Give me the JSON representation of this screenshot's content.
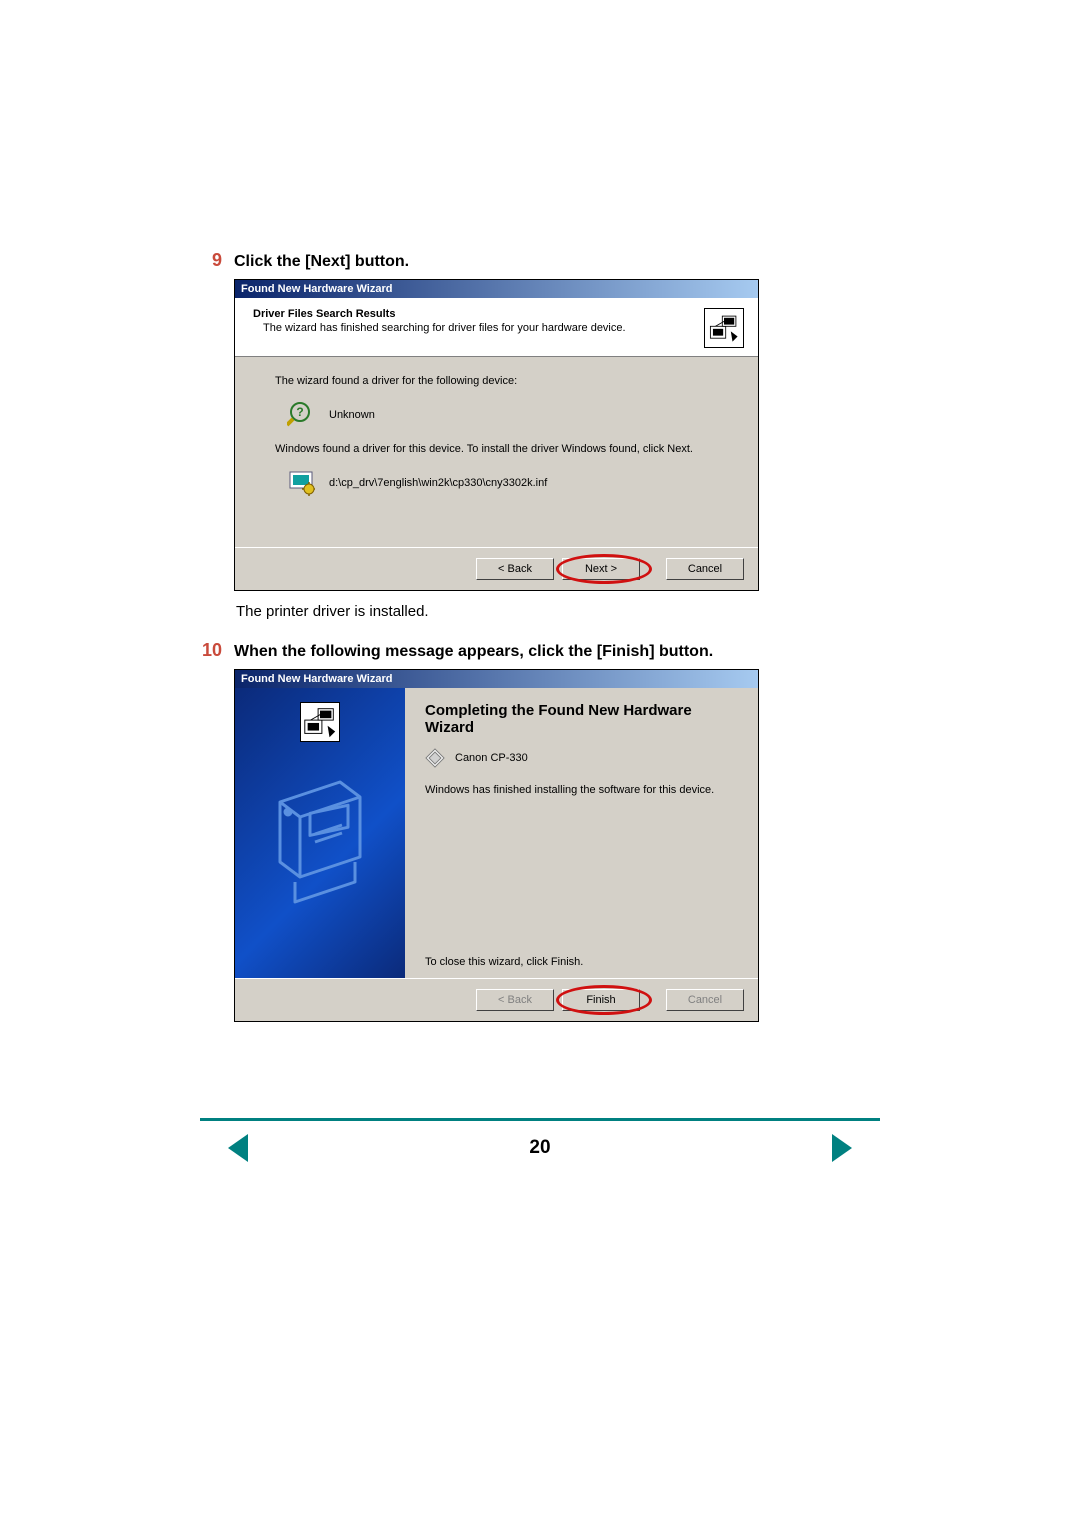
{
  "steps": {
    "s9": {
      "num": "9",
      "title": "Click the [Next] button.",
      "caption": "The printer driver is installed."
    },
    "s10": {
      "num": "10",
      "title": "When the following message appears, click the [Finish] button."
    }
  },
  "wizard1": {
    "titlebar": "Found New Hardware Wizard",
    "header_bold": "Driver Files Search Results",
    "header_sub": "The wizard has finished searching for driver files for your hardware device.",
    "line_found": "The wizard found a driver for the following device:",
    "device_name": "Unknown",
    "line_install": "Windows found a driver for this device. To install the driver Windows found, click Next.",
    "driver_path": "d:\\cp_drv\\7english\\win2k\\cp330\\cny3302k.inf",
    "btn_back": "< Back",
    "btn_next": "Next >",
    "btn_cancel": "Cancel"
  },
  "wizard2": {
    "titlebar": "Found New Hardware Wizard",
    "heading": "Completing the Found New Hardware Wizard",
    "device": "Canon CP-330",
    "finished": "Windows has finished installing the software for this device.",
    "close_line": "To close this wizard, click Finish.",
    "btn_back": "< Back",
    "btn_finish": "Finish",
    "btn_cancel": "Cancel"
  },
  "footer": {
    "page": "20"
  }
}
